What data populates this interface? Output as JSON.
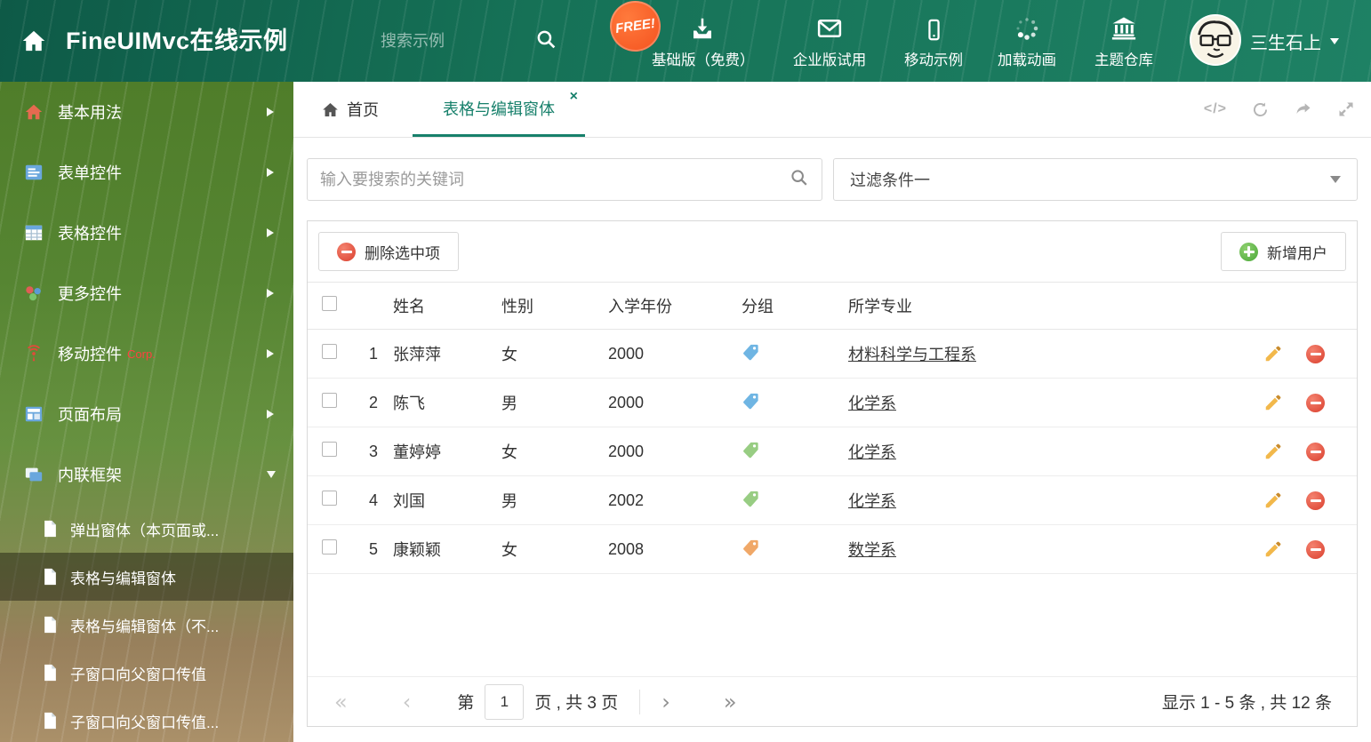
{
  "colors": {
    "accent": "#17806b",
    "delete_red": "#da3f2e",
    "add_green": "#4aa838",
    "pencil_orange": "#f2b84b",
    "free_badge": "#f4511e",
    "corp_red": "#ff4040"
  },
  "header": {
    "title": "FineUIMvc在线示例",
    "search_placeholder": "搜索示例",
    "free_badge": "FREE!",
    "nav": [
      {
        "label": "基础版（免费）"
      },
      {
        "label": "企业版试用"
      },
      {
        "label": "移动示例"
      },
      {
        "label": "加载动画"
      },
      {
        "label": "主题仓库"
      }
    ],
    "user": {
      "name": "三生石上"
    }
  },
  "sidebar": {
    "items": [
      {
        "label": "基本用法"
      },
      {
        "label": "表单控件"
      },
      {
        "label": "表格控件"
      },
      {
        "label": "更多控件"
      },
      {
        "label": "移动控件",
        "badge": "Corp."
      },
      {
        "label": "页面布局"
      },
      {
        "label": "内联框架"
      }
    ],
    "subitems": [
      {
        "label": "弹出窗体（本页面或..."
      },
      {
        "label": "表格与编辑窗体"
      },
      {
        "label": "表格与编辑窗体（不..."
      },
      {
        "label": "子窗口向父窗口传值"
      },
      {
        "label": "子窗口向父窗口传值..."
      }
    ]
  },
  "tabbar": {
    "home": "首页",
    "active": "表格与编辑窗体",
    "close": "×",
    "code_icon": "</>"
  },
  "filters": {
    "search_placeholder": "输入要搜索的关键词",
    "selected_filter": "过滤条件一"
  },
  "toolbar": {
    "delete_label": "删除选中项",
    "add_label": "新增用户"
  },
  "table": {
    "columns": [
      "姓名",
      "性别",
      "入学年份",
      "分组",
      "所学专业"
    ],
    "rows": [
      {
        "num": "1",
        "name": "张萍萍",
        "gender": "女",
        "year": "2000",
        "tag_color": "#6fb5e3",
        "major": "材料科学与工程系"
      },
      {
        "num": "2",
        "name": "陈飞",
        "gender": "男",
        "year": "2000",
        "tag_color": "#6fb5e3",
        "major": "化学系"
      },
      {
        "num": "3",
        "name": "董婷婷",
        "gender": "女",
        "year": "2000",
        "tag_color": "#98cd83",
        "major": "化学系"
      },
      {
        "num": "4",
        "name": "刘国",
        "gender": "男",
        "year": "2002",
        "tag_color": "#98cd83",
        "major": "化学系"
      },
      {
        "num": "5",
        "name": "康颖颖",
        "gender": "女",
        "year": "2008",
        "tag_color": "#f0a868",
        "major": "数学系"
      }
    ]
  },
  "pagination": {
    "page_label": "第",
    "current_page": "1",
    "total_label": "页 , 共 3 页",
    "first": "«",
    "prev": "‹",
    "next": "›",
    "last": "»",
    "summary": "显示 1 - 5 条 , 共 12 条"
  }
}
